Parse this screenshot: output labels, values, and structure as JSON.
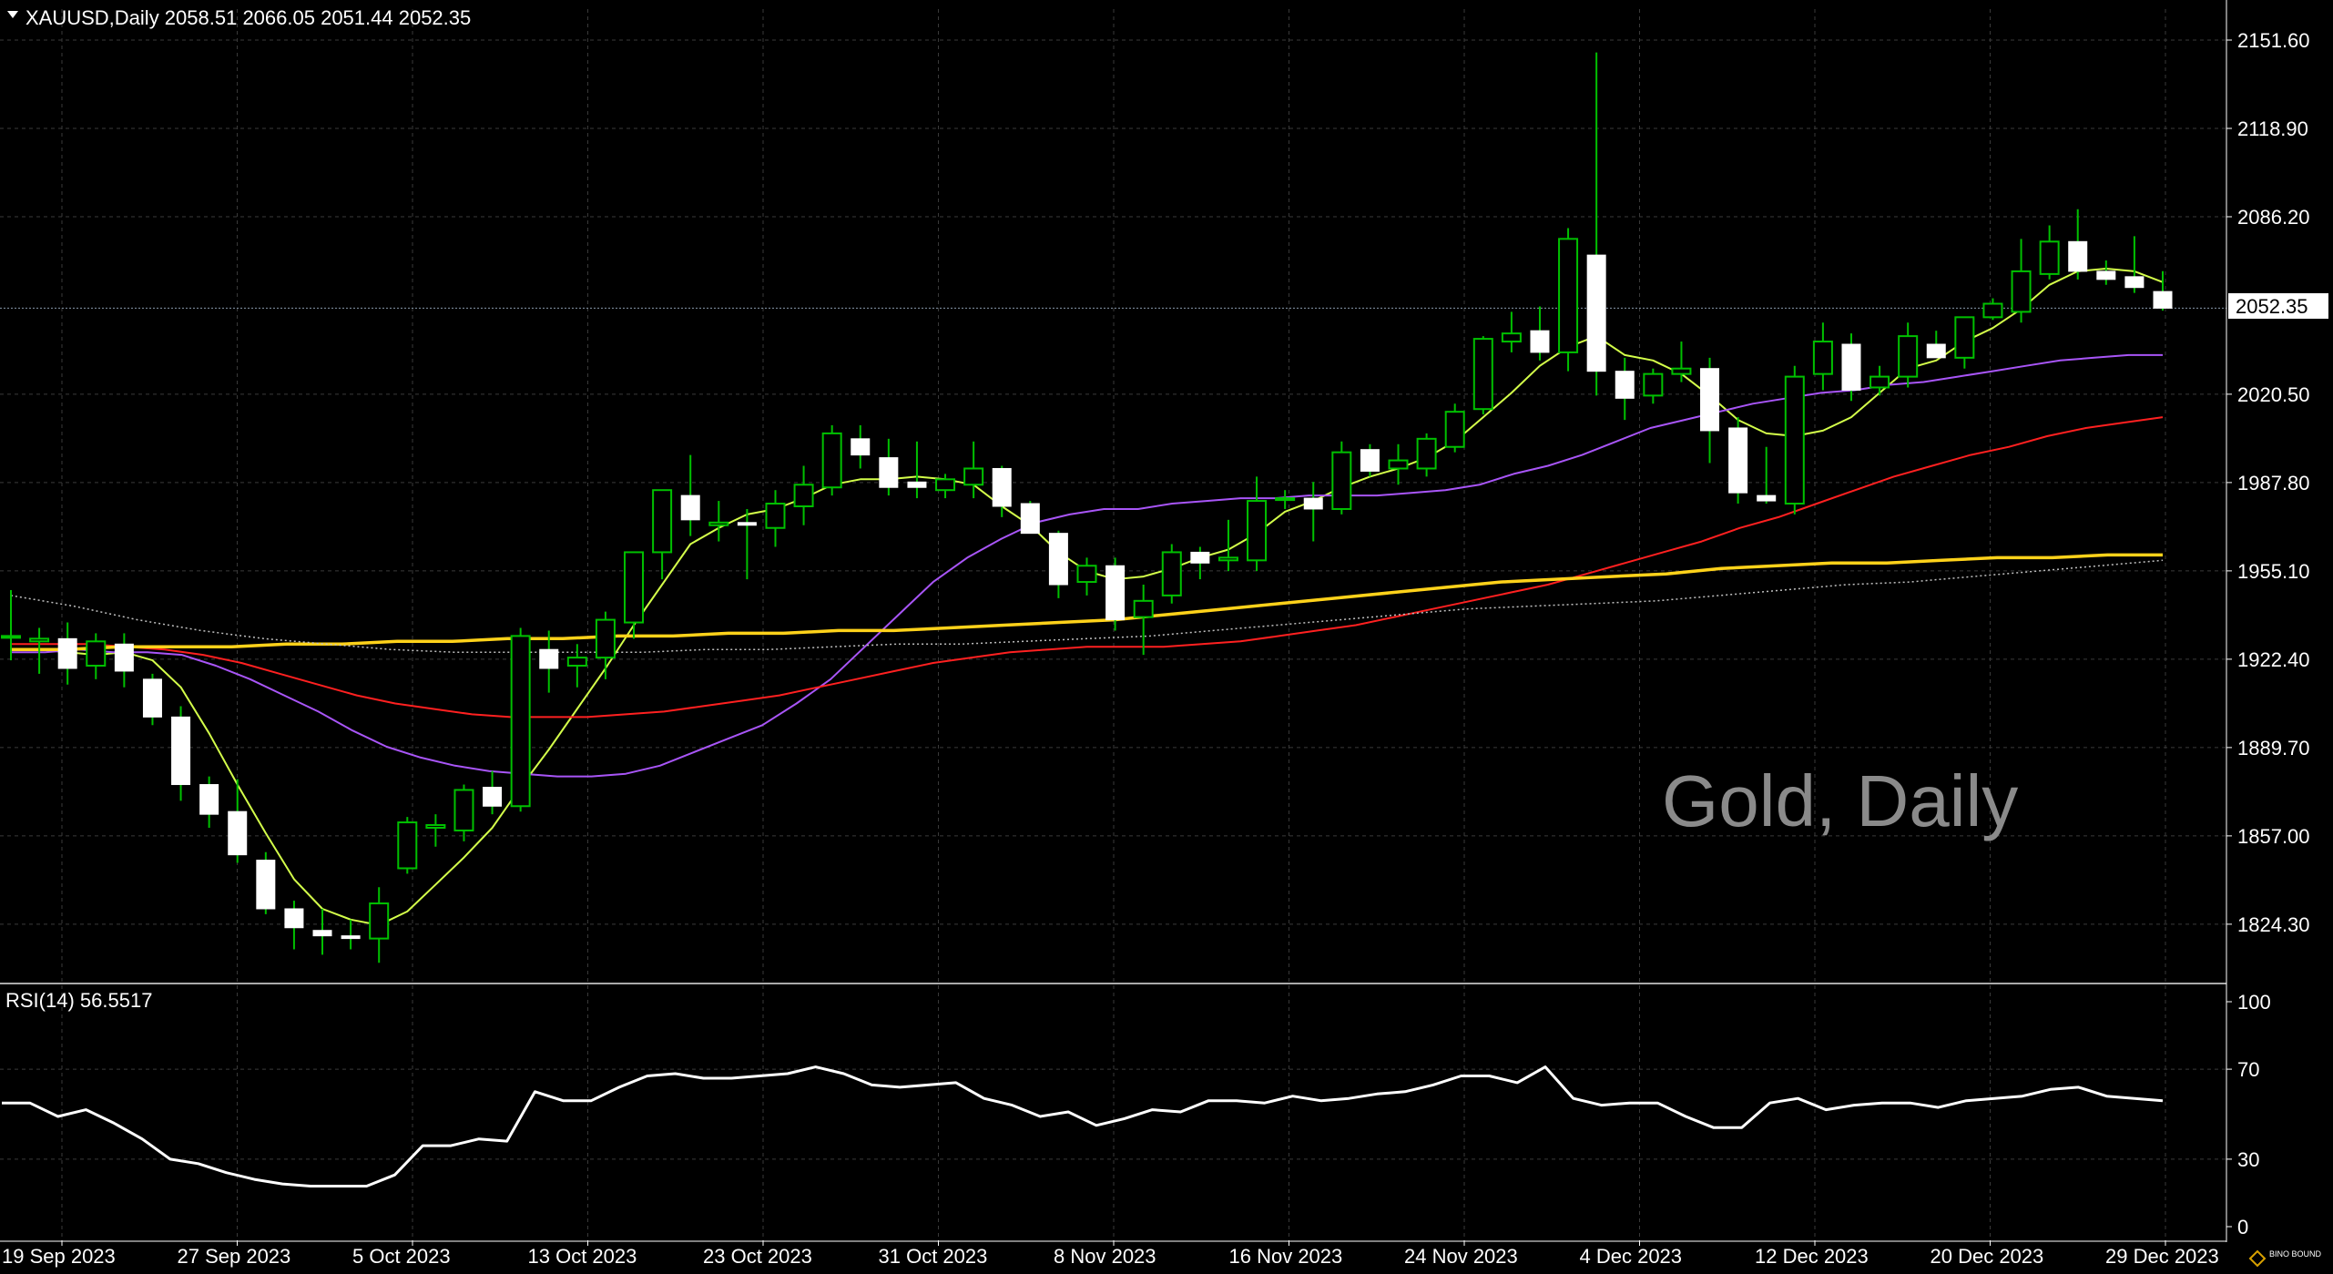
{
  "header": {
    "symbol_line": "XAUUSD,Daily  2058.51 2066.05 2051.44 2052.35",
    "rsi_label": "RSI(14) 56.5517"
  },
  "watermark": "Gold, Daily",
  "current_price_label": "2052.35",
  "logo_text": "BINO BOUND",
  "colors": {
    "background": "#000000",
    "grid": "#3a3a3a",
    "bull_candle": "#00c000",
    "bear_candle": "#ffffff",
    "ma_fast": "#d4ff4a",
    "ma_mid": "#a855f7",
    "ma_slow": "#ff2020",
    "ma_long": "#ffd21a",
    "ma_dotted": "#bfbfbf",
    "rsi": "#ffffff"
  },
  "chart_data": [
    {
      "type": "candlestick",
      "title": "XAUUSD,Daily",
      "price_axis_ticks": [
        "2151.60",
        "2118.90",
        "2086.20",
        "2052.35",
        "2020.50",
        "1987.80",
        "1955.10",
        "1922.40",
        "1889.70",
        "1857.00",
        "1824.30"
      ],
      "date_axis_ticks": [
        "19 Sep 2023",
        "27 Sep 2023",
        "5 Oct 2023",
        "13 Oct 2023",
        "23 Oct 2023",
        "31 Oct 2023",
        "8 Nov 2023",
        "16 Nov 2023",
        "24 Nov 2023",
        "4 Dec 2023",
        "12 Dec 2023",
        "20 Dec 2023",
        "29 Dec 2023"
      ],
      "ylim": [
        1805,
        2165
      ],
      "last_price": 2052.35,
      "grid": true,
      "candles": [
        {
          "o": 1931,
          "h": 1948,
          "l": 1922,
          "c": 1931
        },
        {
          "o": 1929,
          "h": 1934,
          "l": 1917,
          "c": 1930
        },
        {
          "o": 1930,
          "h": 1936,
          "l": 1913,
          "c": 1919
        },
        {
          "o": 1920,
          "h": 1932,
          "l": 1915,
          "c": 1929
        },
        {
          "o": 1928,
          "h": 1932,
          "l": 1912,
          "c": 1918
        },
        {
          "o": 1915,
          "h": 1917,
          "l": 1898,
          "c": 1901
        },
        {
          "o": 1901,
          "h": 1905,
          "l": 1870,
          "c": 1876
        },
        {
          "o": 1876,
          "h": 1879,
          "l": 1860,
          "c": 1865
        },
        {
          "o": 1866,
          "h": 1878,
          "l": 1847,
          "c": 1850
        },
        {
          "o": 1848,
          "h": 1851,
          "l": 1828,
          "c": 1830
        },
        {
          "o": 1830,
          "h": 1833,
          "l": 1815,
          "c": 1823
        },
        {
          "o": 1822,
          "h": 1830,
          "l": 1813,
          "c": 1820
        },
        {
          "o": 1820,
          "h": 1826,
          "l": 1815,
          "c": 1819
        },
        {
          "o": 1819,
          "h": 1838,
          "l": 1810,
          "c": 1832
        },
        {
          "o": 1845,
          "h": 1864,
          "l": 1843,
          "c": 1862
        },
        {
          "o": 1860,
          "h": 1865,
          "l": 1853,
          "c": 1861
        },
        {
          "o": 1859,
          "h": 1876,
          "l": 1855,
          "c": 1874
        },
        {
          "o": 1875,
          "h": 1881,
          "l": 1865,
          "c": 1868
        },
        {
          "o": 1868,
          "h": 1934,
          "l": 1866,
          "c": 1931
        },
        {
          "o": 1926,
          "h": 1933,
          "l": 1910,
          "c": 1919
        },
        {
          "o": 1920,
          "h": 1928,
          "l": 1912,
          "c": 1923
        },
        {
          "o": 1923,
          "h": 1940,
          "l": 1915,
          "c": 1937
        },
        {
          "o": 1936,
          "h": 1962,
          "l": 1930,
          "c": 1962
        },
        {
          "o": 1962,
          "h": 1985,
          "l": 1952,
          "c": 1985
        },
        {
          "o": 1983,
          "h": 1998,
          "l": 1968,
          "c": 1974
        },
        {
          "o": 1972,
          "h": 1981,
          "l": 1966,
          "c": 1973
        },
        {
          "o": 1973,
          "h": 1978,
          "l": 1952,
          "c": 1972
        },
        {
          "o": 1971,
          "h": 1985,
          "l": 1964,
          "c": 1980
        },
        {
          "o": 1979,
          "h": 1994,
          "l": 1972,
          "c": 1987
        },
        {
          "o": 1986,
          "h": 2009,
          "l": 1983,
          "c": 2006
        },
        {
          "o": 2004,
          "h": 2009,
          "l": 1993,
          "c": 1998
        },
        {
          "o": 1997,
          "h": 2004,
          "l": 1983,
          "c": 1986
        },
        {
          "o": 1988,
          "h": 2003,
          "l": 1982,
          "c": 1986
        },
        {
          "o": 1985,
          "h": 1991,
          "l": 1982,
          "c": 1989
        },
        {
          "o": 1987,
          "h": 2003,
          "l": 1982,
          "c": 1993
        },
        {
          "o": 1993,
          "h": 1994,
          "l": 1975,
          "c": 1979
        },
        {
          "o": 1980,
          "h": 1981,
          "l": 1970,
          "c": 1969
        },
        {
          "o": 1969,
          "h": 1970,
          "l": 1945,
          "c": 1950
        },
        {
          "o": 1951,
          "h": 1960,
          "l": 1946,
          "c": 1957
        },
        {
          "o": 1957,
          "h": 1960,
          "l": 1933,
          "c": 1937
        },
        {
          "o": 1938,
          "h": 1950,
          "l": 1924,
          "c": 1944
        },
        {
          "o": 1946,
          "h": 1965,
          "l": 1943,
          "c": 1962
        },
        {
          "o": 1962,
          "h": 1964,
          "l": 1952,
          "c": 1958
        },
        {
          "o": 1959,
          "h": 1974,
          "l": 1955,
          "c": 1960
        },
        {
          "o": 1959,
          "h": 1990,
          "l": 1955,
          "c": 1981
        },
        {
          "o": 1982,
          "h": 1985,
          "l": 1978,
          "c": 1982
        },
        {
          "o": 1982,
          "h": 1988,
          "l": 1966,
          "c": 1978
        },
        {
          "o": 1978,
          "h": 2003,
          "l": 1976,
          "c": 1999
        },
        {
          "o": 2000,
          "h": 2002,
          "l": 1990,
          "c": 1992
        },
        {
          "o": 1993,
          "h": 2002,
          "l": 1987,
          "c": 1996
        },
        {
          "o": 1993,
          "h": 2006,
          "l": 1990,
          "c": 2004
        },
        {
          "o": 2001,
          "h": 2017,
          "l": 1999,
          "c": 2014
        },
        {
          "o": 2015,
          "h": 2042,
          "l": 2013,
          "c": 2041
        },
        {
          "o": 2040,
          "h": 2051,
          "l": 2036,
          "c": 2043
        },
        {
          "o": 2044,
          "h": 2053,
          "l": 2033,
          "c": 2036
        },
        {
          "o": 2036,
          "h": 2082,
          "l": 2029,
          "c": 2078
        },
        {
          "o": 2072,
          "h": 2147,
          "l": 2020,
          "c": 2029
        },
        {
          "o": 2029,
          "h": 2034,
          "l": 2011,
          "c": 2019
        },
        {
          "o": 2020,
          "h": 2030,
          "l": 2017,
          "c": 2028
        },
        {
          "o": 2028,
          "h": 2040,
          "l": 2025,
          "c": 2030
        },
        {
          "o": 2030,
          "h": 2034,
          "l": 1995,
          "c": 2007
        },
        {
          "o": 2008,
          "h": 2012,
          "l": 1980,
          "c": 1984
        },
        {
          "o": 1983,
          "h": 2001,
          "l": 1980,
          "c": 1981
        },
        {
          "o": 1980,
          "h": 2031,
          "l": 1976,
          "c": 2027
        },
        {
          "o": 2028,
          "h": 2047,
          "l": 2022,
          "c": 2040
        },
        {
          "o": 2039,
          "h": 2043,
          "l": 2018,
          "c": 2022
        },
        {
          "o": 2023,
          "h": 2031,
          "l": 2020,
          "c": 2027
        },
        {
          "o": 2027,
          "h": 2047,
          "l": 2023,
          "c": 2042
        },
        {
          "o": 2039,
          "h": 2044,
          "l": 2035,
          "c": 2034
        },
        {
          "o": 2034,
          "h": 2048,
          "l": 2030,
          "c": 2049
        },
        {
          "o": 2049,
          "h": 2056,
          "l": 2048,
          "c": 2054
        },
        {
          "o": 2051,
          "h": 2078,
          "l": 2047,
          "c": 2066
        },
        {
          "o": 2065,
          "h": 2083,
          "l": 2063,
          "c": 2077
        },
        {
          "o": 2077,
          "h": 2089,
          "l": 2063,
          "c": 2066
        },
        {
          "o": 2066,
          "h": 2070,
          "l": 2061,
          "c": 2063
        },
        {
          "o": 2064,
          "h": 2079,
          "l": 2058,
          "c": 2060
        },
        {
          "o": 2058.51,
          "h": 2066.05,
          "l": 2051.44,
          "c": 2052.35
        }
      ],
      "series": [
        {
          "name": "",
          "color": "ma_fast",
          "style": "solid",
          "values": [
            1926,
            1926,
            1925,
            1924,
            1925,
            1922,
            1912,
            1895,
            1876,
            1858,
            1841,
            1830,
            1826,
            1824,
            1829,
            1839,
            1849,
            1860,
            1875,
            1889,
            1904,
            1919,
            1935,
            1950,
            1965,
            1971,
            1976,
            1978,
            1982,
            1987,
            1989,
            1989,
            1990,
            1989,
            1987,
            1979,
            1972,
            1962,
            1955,
            1952,
            1953,
            1956,
            1960,
            1963,
            1969,
            1977,
            1981,
            1986,
            1990,
            1993,
            1997,
            2003,
            2012,
            2021,
            2031,
            2038,
            2042,
            2035,
            2033,
            2028,
            2020,
            2011,
            2006,
            2005,
            2007,
            2012,
            2021,
            2030,
            2033,
            2040,
            2045,
            2052,
            2061,
            2066,
            2067,
            2066,
            2062
          ]
        },
        {
          "name": "",
          "color": "ma_mid",
          "style": "solid",
          "values": [
            1925,
            1925,
            1926,
            1925,
            1925,
            1924,
            1920,
            1915,
            1909,
            1903,
            1896,
            1890,
            1886,
            1883,
            1881,
            1880,
            1879,
            1879,
            1880,
            1883,
            1888,
            1893,
            1898,
            1906,
            1915,
            1927,
            1939,
            1951,
            1960,
            1967,
            1973,
            1976,
            1978,
            1978,
            1980,
            1981,
            1982,
            1982,
            1983,
            1983,
            1983,
            1984,
            1985,
            1987,
            1991,
            1994,
            1998,
            2003,
            2008,
            2011,
            2014,
            2017,
            2019,
            2021,
            2022,
            2024,
            2025,
            2027,
            2029,
            2031,
            2033,
            2034,
            2035,
            2035
          ]
        },
        {
          "name": "",
          "color": "ma_slow",
          "style": "solid",
          "values": [
            1928,
            1928,
            1928,
            1927,
            1926,
            1924,
            1921,
            1917,
            1913,
            1909,
            1906,
            1904,
            1902,
            1901,
            1901,
            1901,
            1902,
            1903,
            1905,
            1907,
            1909,
            1912,
            1915,
            1918,
            1921,
            1923,
            1925,
            1926,
            1927,
            1927,
            1927,
            1928,
            1929,
            1931,
            1933,
            1935,
            1938,
            1941,
            1944,
            1947,
            1950,
            1954,
            1958,
            1962,
            1966,
            1971,
            1975,
            1980,
            1985,
            1990,
            1994,
            1998,
            2001,
            2005,
            2008,
            2010,
            2012
          ]
        },
        {
          "name": "",
          "color": "ma_long",
          "style": "solid",
          "values": [
            1926,
            1926,
            1927,
            1927,
            1927,
            1928,
            1928,
            1929,
            1929,
            1930,
            1930,
            1931,
            1931,
            1932,
            1932,
            1933,
            1933,
            1934,
            1935,
            1936,
            1937,
            1939,
            1941,
            1943,
            1945,
            1947,
            1949,
            1951,
            1952,
            1953,
            1954,
            1956,
            1957,
            1958,
            1958,
            1959,
            1960,
            1960,
            1961,
            1961
          ]
        },
        {
          "name": "",
          "color": "ma_dotted",
          "style": "dotted",
          "values": [
            1946,
            1942,
            1937,
            1933,
            1930,
            1928,
            1926,
            1925,
            1925,
            1925,
            1925,
            1926,
            1926,
            1927,
            1928,
            1928,
            1929,
            1930,
            1931,
            1933,
            1935,
            1937,
            1939,
            1941,
            1942,
            1943,
            1944,
            1946,
            1948,
            1950,
            1951,
            1953,
            1955,
            1957,
            1959
          ]
        }
      ]
    },
    {
      "type": "line",
      "title": "RSI(14) 56.5517",
      "ylim": [
        0,
        100
      ],
      "y_ticks": [
        "100",
        "70",
        "30",
        "0"
      ],
      "levels": [
        70,
        30
      ],
      "values": [
        55,
        55,
        49,
        52,
        46,
        39,
        30,
        28,
        24,
        21,
        19,
        18,
        18,
        18,
        23,
        36,
        36,
        39,
        38,
        60,
        56,
        56,
        62,
        67,
        68,
        66,
        66,
        67,
        68,
        71,
        68,
        63,
        62,
        63,
        64,
        57,
        54,
        49,
        51,
        45,
        48,
        52,
        51,
        56,
        56,
        55,
        58,
        56,
        57,
        59,
        60,
        63,
        67,
        67,
        64,
        71,
        57,
        54,
        55,
        55,
        49,
        44,
        44,
        55,
        57,
        52,
        54,
        55,
        55,
        53,
        56,
        57,
        58,
        61,
        62,
        58,
        57,
        56
      ]
    }
  ]
}
